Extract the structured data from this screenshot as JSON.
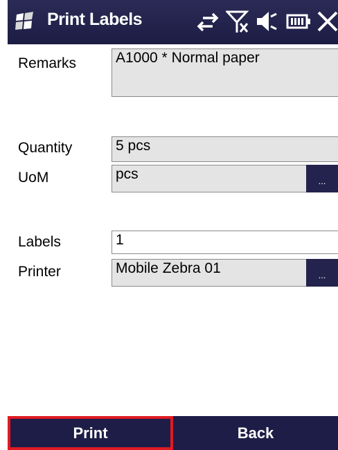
{
  "window": {
    "title": "Print Labels"
  },
  "status_icons": [
    "windows-logo-icon",
    "data-sync-icon",
    "no-signal-icon",
    "volume-icon",
    "battery-icon",
    "close-icon"
  ],
  "form": {
    "remarks": {
      "label": "Remarks",
      "value": "A1000 * Normal paper"
    },
    "quantity": {
      "label": "Quantity",
      "value": "5 pcs"
    },
    "uom": {
      "label": "UoM",
      "value": "pcs",
      "picker": "..."
    },
    "labels": {
      "label": "Labels",
      "value": "1"
    },
    "printer": {
      "label": "Printer",
      "value": "Mobile Zebra 01",
      "picker": "..."
    }
  },
  "softkeys": {
    "left": "Print",
    "right": "Back"
  },
  "colors": {
    "bar": "#1d1d47",
    "highlight": "#e01a22",
    "field": "#e4e4e4"
  }
}
